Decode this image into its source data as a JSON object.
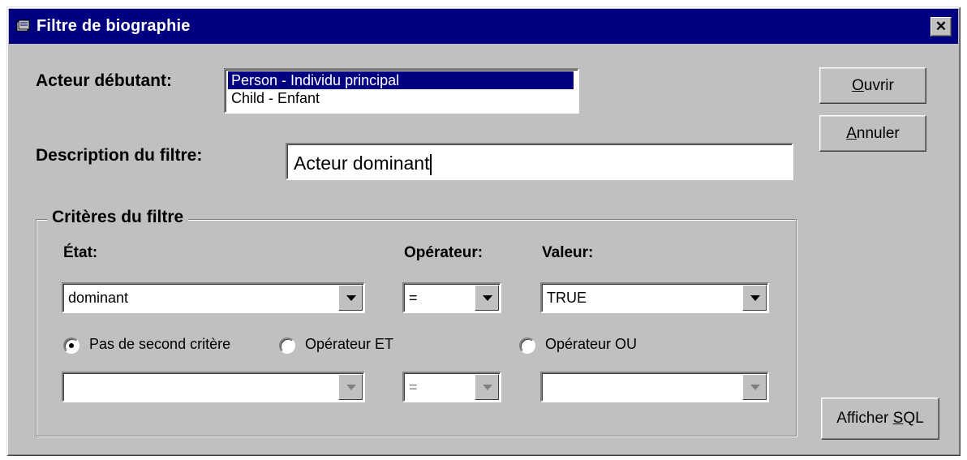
{
  "window": {
    "title": "Filtre de biographie",
    "close_glyph": "✕"
  },
  "acteur": {
    "label": "Acteur débutant:",
    "items": [
      "Person - Individu principal",
      "Child - Enfant"
    ],
    "selected_index": 0
  },
  "description": {
    "label": "Description du filtre:",
    "value": "Acteur dominant"
  },
  "buttons": {
    "ouvrir": {
      "underline": "O",
      "rest": "uvrir"
    },
    "annuler": {
      "underline": "A",
      "rest": "nnuler"
    },
    "sql": {
      "pre": "Afficher ",
      "underline": "S",
      "rest": "QL"
    }
  },
  "criteria": {
    "group_title": "Critères du filtre",
    "etat_label": "État:",
    "operateur_label": "Opérateur:",
    "valeur_label": "Valeur:",
    "row1": {
      "etat": "dominant",
      "operateur": "=",
      "valeur": "TRUE"
    },
    "radios": {
      "none": "Pas de second critère",
      "and": "Opérateur ET",
      "or": "Opérateur OU",
      "selected": "none"
    },
    "row2": {
      "etat": "",
      "operateur": "=",
      "valeur": "",
      "enabled": false
    }
  },
  "icons": {
    "window_icon": "book-icon",
    "close": "close-icon",
    "dropdown": "chevron-down-icon"
  }
}
